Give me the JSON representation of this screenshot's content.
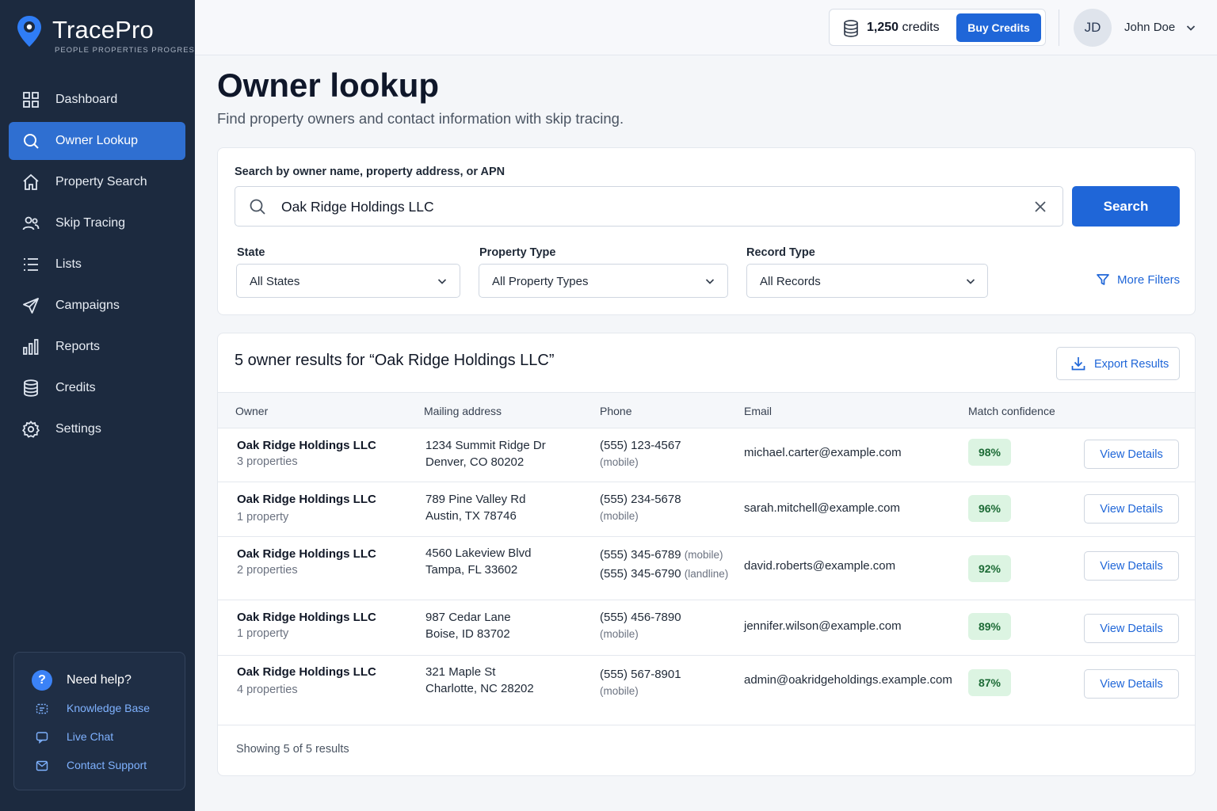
{
  "brand": {
    "name": "TracePro",
    "tagline": "PEOPLE  PROPERTIES  PROGRESS"
  },
  "sidebar": {
    "items": [
      {
        "label": "Dashboard",
        "icon": "grid-icon"
      },
      {
        "label": "Owner Lookup",
        "icon": "search-icon",
        "active": true
      },
      {
        "label": "Property Search",
        "icon": "home-icon"
      },
      {
        "label": "Skip Tracing",
        "icon": "users-icon"
      },
      {
        "label": "Lists",
        "icon": "list-icon"
      },
      {
        "label": "Campaigns",
        "icon": "send-icon"
      },
      {
        "label": "Reports",
        "icon": "bar-chart-icon"
      },
      {
        "label": "Credits",
        "icon": "database-icon"
      },
      {
        "label": "Settings",
        "icon": "gear-icon"
      }
    ],
    "help": {
      "title": "Need help?",
      "links": [
        "Knowledge Base",
        "Live Chat",
        "Contact Support"
      ]
    }
  },
  "topbar": {
    "credits_amount": "1,250",
    "credits_suffix": " credits",
    "buy_label": "Buy Credits",
    "avatar_initials": "JD",
    "user_name": "John Doe"
  },
  "page": {
    "title": "Owner lookup",
    "subtitle": "Find property owners and contact information with skip tracing."
  },
  "search": {
    "label": "Search by owner name, property address, or APN",
    "value": "Oak Ridge Holdings LLC",
    "button": "Search",
    "filters": [
      {
        "label": "State",
        "value": "All States"
      },
      {
        "label": "Property Type",
        "value": "All Property Types"
      },
      {
        "label": "Record Type",
        "value": "All Records"
      }
    ],
    "more_filters": "More Filters"
  },
  "results": {
    "title": "5 owner results for “Oak Ridge Holdings LLC”",
    "export_label": "Export Results",
    "columns": [
      "Owner",
      "Mailing address",
      "Phone",
      "Email",
      "Match confidence"
    ],
    "view_label": "View Details",
    "rows": [
      {
        "owner": "Oak Ridge Holdings LLC",
        "properties": "3 properties",
        "addr1": "1234 Summit Ridge Dr",
        "addr2": "Denver, CO 80202",
        "phone1": "(555) 123-4567",
        "phone1_type": "",
        "phone2": "(mobile)",
        "phone2_type": "",
        "email": "michael.carter@example.com",
        "confidence": "98%"
      },
      {
        "owner": "Oak Ridge Holdings LLC",
        "properties": "1 property",
        "addr1": "789 Pine Valley Rd",
        "addr2": "Austin, TX 78746",
        "phone1": "(555) 234-5678",
        "phone1_type": "",
        "phone2": "(mobile)",
        "phone2_type": "",
        "email": "sarah.mitchell@example.com",
        "confidence": "96%"
      },
      {
        "owner": "Oak Ridge Holdings LLC",
        "properties": "2 properties",
        "addr1": "4560 Lakeview Blvd",
        "addr2": "Tampa, FL 33602",
        "phone1": "(555) 345-6789",
        "phone1_type": "(mobile)",
        "phone2": "(555) 345-6790",
        "phone2_type": "(landline)",
        "email": "david.roberts@example.com",
        "confidence": "92%"
      },
      {
        "owner": "Oak Ridge Holdings LLC",
        "properties": "1 property",
        "addr1": "987 Cedar Lane",
        "addr2": "Boise, ID 83702",
        "phone1": "(555) 456-7890",
        "phone1_type": "",
        "phone2": "(mobile)",
        "phone2_type": "",
        "email": "jennifer.wilson@example.com",
        "confidence": "89%"
      },
      {
        "owner": "Oak Ridge Holdings LLC",
        "properties": "4 properties",
        "addr1": "321 Maple St",
        "addr2": "Charlotte, NC 28202",
        "phone1": "(555) 567-8901",
        "phone1_type": "",
        "phone2": "(mobile)",
        "phone2_type": "",
        "email": "admin@oakridgeholdings.example.com",
        "confidence": "87%"
      }
    ],
    "footer": "Showing 5 of 5 results"
  },
  "colors": {
    "sidebar": "#1c2a3f",
    "accent": "#1f66d8",
    "badge_bg": "#dcf4e2",
    "badge_text": "#1d6b36"
  }
}
